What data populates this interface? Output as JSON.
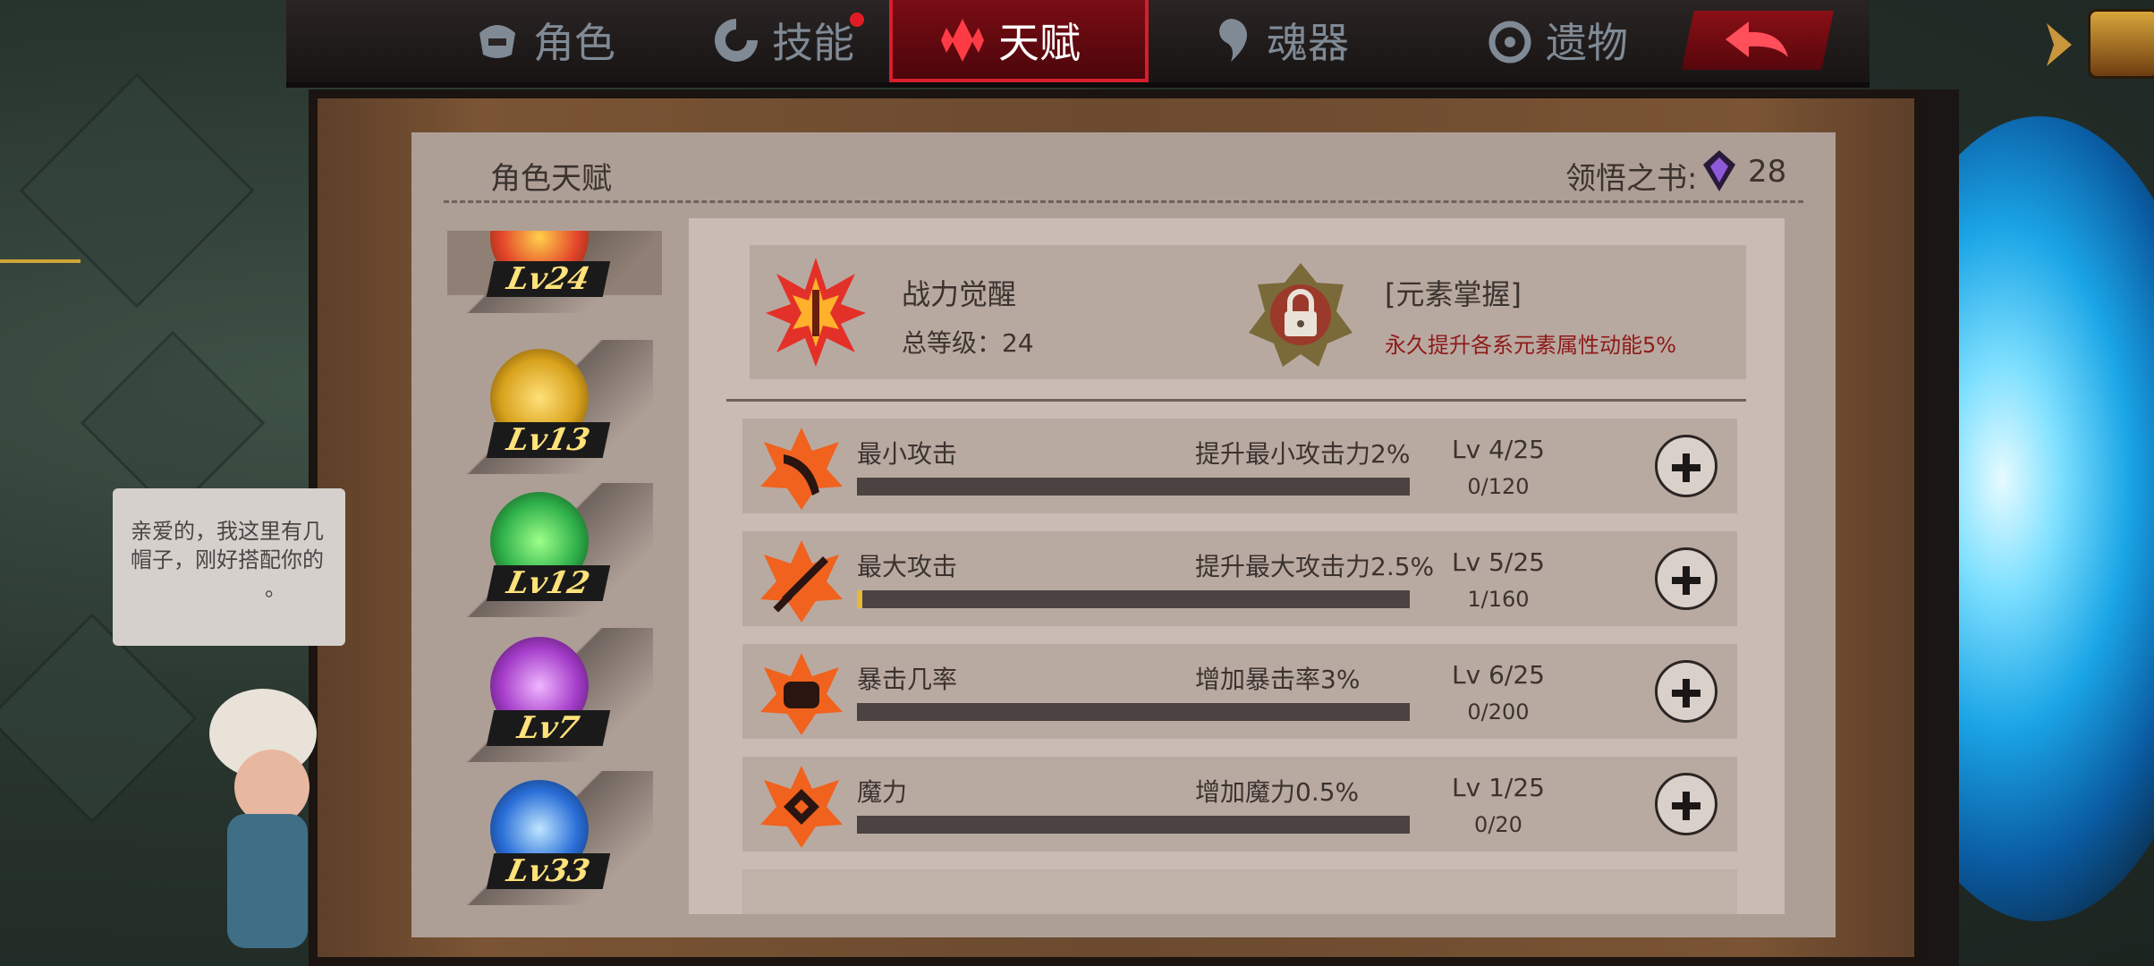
{
  "tabs": [
    {
      "label": "角色",
      "icon": "helmet-icon",
      "active": false
    },
    {
      "label": "技能",
      "icon": "skill-icon",
      "active": false,
      "badge": true
    },
    {
      "label": "天赋",
      "icon": "talent-icon",
      "active": true
    },
    {
      "label": "魂器",
      "icon": "soul-icon",
      "active": false
    },
    {
      "label": "遗物",
      "icon": "relic-icon",
      "active": false
    }
  ],
  "back_button_icon": "back-arrow-icon",
  "panel": {
    "title": "角色天赋",
    "book_label": "领悟之书:",
    "book_count": "28"
  },
  "characters": [
    {
      "level_text": "Lv24",
      "color": "#e3452a"
    },
    {
      "level_text": "Lv13",
      "color": "#d8a21c"
    },
    {
      "level_text": "Lv12",
      "color": "#2fb04a"
    },
    {
      "level_text": "Lv7",
      "color": "#a43cc9"
    },
    {
      "level_text": "Lv33",
      "color": "#2a6fd8"
    }
  ],
  "awakening": {
    "title": "战力觉醒",
    "level_label": "总等级：24",
    "locked_title": "[元素掌握]",
    "locked_desc": "永久提升各系元素属性动能5%"
  },
  "talents": [
    {
      "name": "最小攻击",
      "desc": "提升最小攻击力2%",
      "level": "Lv 4/25",
      "xp": "0/120",
      "progress": 0,
      "icon": "blade-icon"
    },
    {
      "name": "最大攻击",
      "desc": "提升最大攻击力2.5%",
      "level": "Lv 5/25",
      "xp": "1/160",
      "progress": 0.00625,
      "icon": "sword-icon"
    },
    {
      "name": "暴击几率",
      "desc": "增加暴击率3%",
      "level": "Lv 6/25",
      "xp": "0/200",
      "progress": 0,
      "icon": "fist-icon"
    },
    {
      "name": "魔力",
      "desc": "增加魔力0.5%",
      "level": "Lv 1/25",
      "xp": "0/20",
      "progress": 0,
      "icon": "magic-icon"
    }
  ],
  "npc": {
    "line1": "亲爱的，我这里有几",
    "line2": "帽子，刚好搭配你的",
    "line3": "。"
  },
  "colors": {
    "accent_red": "#d61f2b",
    "panel": "#ae9f96",
    "desc_red": "#8e1a1a",
    "progress": "#e6b83a"
  }
}
